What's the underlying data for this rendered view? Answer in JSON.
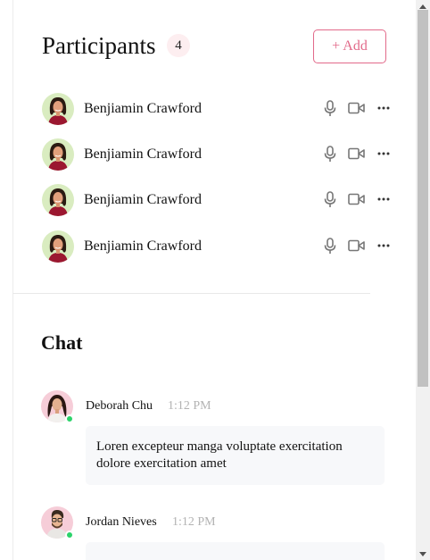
{
  "participants": {
    "title": "Participants",
    "count": "4",
    "add_label": "+ Add",
    "items": [
      {
        "name": "Benjiamin Crawford"
      },
      {
        "name": "Benjiamin Crawford"
      },
      {
        "name": "Benjiamin Crawford"
      },
      {
        "name": "Benjiamin Crawford"
      }
    ]
  },
  "chat": {
    "title": "Chat",
    "messages": [
      {
        "author": "Deborah Chu",
        "time": "1:12 PM",
        "text": "Loren excepteur manga voluptate exercitation dolore exercitation amet",
        "online": true
      },
      {
        "author": "Jordan Nieves",
        "time": "1:12 PM",
        "text": "",
        "online": true
      }
    ]
  },
  "colors": {
    "accent": "#e26a8a",
    "badge_bg": "#fdeef0",
    "online": "#2bd36a",
    "bubble_bg": "#f7f8fa",
    "muted": "#b3b3b3"
  },
  "icons": {
    "microphone": "microphone-icon",
    "camera": "video-camera-icon",
    "more": "more-horizontal-icon"
  }
}
